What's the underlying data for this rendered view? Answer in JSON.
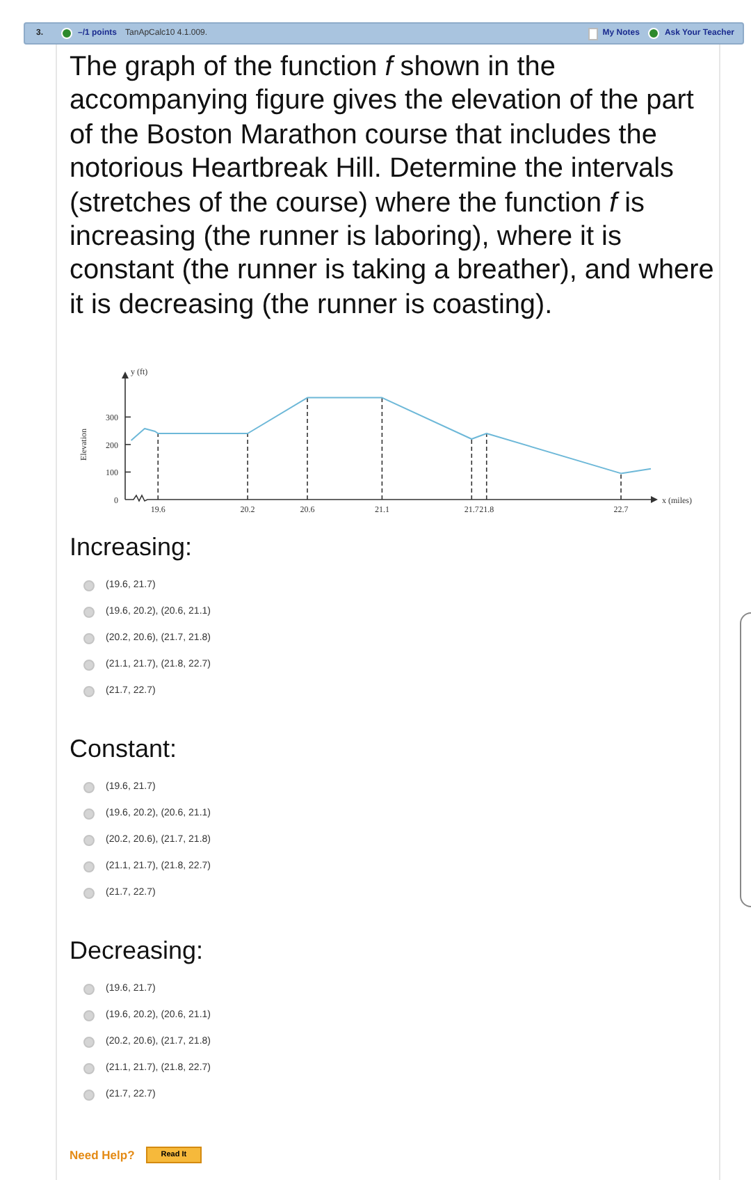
{
  "header": {
    "number": "3.",
    "points": "–/1 points",
    "source": "TanApCalc10 4.1.009.",
    "links": [
      {
        "kind": "notes",
        "label": "My Notes"
      },
      {
        "kind": "teacher",
        "label": "Ask Your Teacher"
      }
    ]
  },
  "question": "The graph of the function *f* shown in the accompanying figure gives the elevation of the part of the Boston Marathon course that includes the notorious Heartbreak Hill. Determine the intervals (stretches of the course) where the function *f* is increasing (the runner is laboring), where it is constant (the runner is taking a breather), and where it is decreasing (the runner is coasting).",
  "figure": {
    "chart_data": {
      "type": "line",
      "ylabel": "Elevation",
      "xlabel": "x (miles)",
      "annotations": [
        {
          "text": "y (ft)"
        }
      ],
      "xlim": [
        19.38,
        22.9
      ],
      "ylim": [
        0,
        440
      ],
      "x": [
        19.42,
        19.51,
        19.58,
        19.6,
        20.2,
        20.6,
        21.1,
        21.7,
        21.8,
        22.7,
        22.9
      ],
      "series": [
        {
          "color": "#6db8d8",
          "values": [
            215,
            258,
            248,
            240,
            240,
            370,
            370,
            220,
            240,
            95,
            112
          ]
        }
      ],
      "xticks": [
        19.6,
        20.2,
        20.6,
        21.1,
        21.7,
        21.8,
        22.7
      ],
      "yticks": [
        0,
        100,
        200,
        300
      ]
    }
  },
  "groups": [
    {
      "title": "Increasing:",
      "options": [
        {
          "label": "(19.6, 21.7)",
          "selected": false
        },
        {
          "label": "(19.6, 20.2), (20.6, 21.1)",
          "selected": false
        },
        {
          "label": "(20.2, 20.6), (21.7, 21.8)",
          "selected": false
        },
        {
          "label": "(21.1, 21.7), (21.8, 22.7)",
          "selected": false
        },
        {
          "label": "(21.7, 22.7)",
          "selected": false
        }
      ]
    },
    {
      "title": "Constant:",
      "options": [
        {
          "label": "(19.6, 21.7)",
          "selected": false
        },
        {
          "label": "(19.6, 20.2), (20.6, 21.1)",
          "selected": false
        },
        {
          "label": "(20.2, 20.6), (21.7, 21.8)",
          "selected": false
        },
        {
          "label": "(21.1, 21.7), (21.8, 22.7)",
          "selected": false
        },
        {
          "label": "(21.7, 22.7)",
          "selected": false
        }
      ]
    },
    {
      "title": "Decreasing:",
      "options": [
        {
          "label": "(19.6, 21.7)",
          "selected": false
        },
        {
          "label": "(19.6, 20.2), (20.6, 21.1)",
          "selected": false
        },
        {
          "label": "(20.2, 20.6), (21.7, 21.8)",
          "selected": false
        },
        {
          "label": "(21.1, 21.7), (21.8, 22.7)",
          "selected": false
        },
        {
          "label": "(21.7, 22.7)",
          "selected": false
        }
      ]
    }
  ],
  "help": {
    "label": "Need Help?",
    "button": "Read It"
  }
}
